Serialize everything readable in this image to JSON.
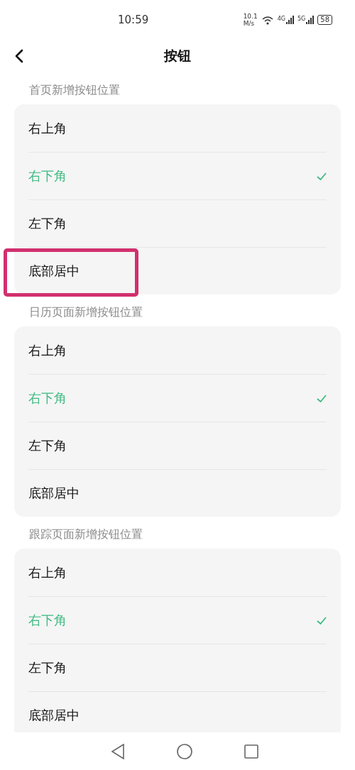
{
  "status_bar": {
    "time": "10:59",
    "speed_value": "10.1",
    "speed_unit": "M/s",
    "network_1": "4G",
    "network_2": "5G",
    "battery": "58"
  },
  "header": {
    "title": "按钮"
  },
  "sections": [
    {
      "label": "首页新增按钮位置",
      "options": [
        {
          "label": "右上角",
          "selected": false,
          "highlighted": false
        },
        {
          "label": "右下角",
          "selected": true,
          "highlighted": false
        },
        {
          "label": "左下角",
          "selected": false,
          "highlighted": false
        },
        {
          "label": "底部居中",
          "selected": false,
          "highlighted": true
        }
      ]
    },
    {
      "label": "日历页面新增按钮位置",
      "options": [
        {
          "label": "右上角",
          "selected": false,
          "highlighted": false
        },
        {
          "label": "右下角",
          "selected": true,
          "highlighted": false
        },
        {
          "label": "左下角",
          "selected": false,
          "highlighted": false
        },
        {
          "label": "底部居中",
          "selected": false,
          "highlighted": false
        }
      ]
    },
    {
      "label": "跟踪页面新增按钮位置",
      "options": [
        {
          "label": "右上角",
          "selected": false,
          "highlighted": false
        },
        {
          "label": "右下角",
          "selected": true,
          "highlighted": false
        },
        {
          "label": "左下角",
          "selected": false,
          "highlighted": false
        },
        {
          "label": "底部居中",
          "selected": false,
          "highlighted": false
        }
      ]
    }
  ]
}
